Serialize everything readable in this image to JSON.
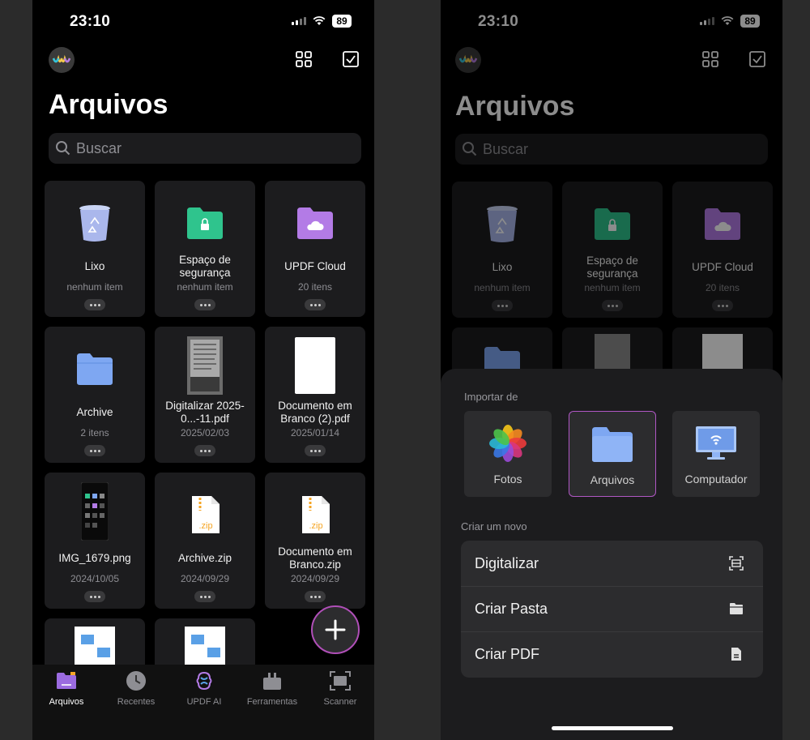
{
  "status": {
    "time": "23:10",
    "battery": "89"
  },
  "title": "Arquivos",
  "search": {
    "placeholder": "Buscar"
  },
  "grid": [
    {
      "name": "Lixo",
      "meta": "nenhum item",
      "icon": "trash-icon"
    },
    {
      "name": "Espaço de segurança",
      "meta": "nenhum item",
      "icon": "secure-folder-icon"
    },
    {
      "name": "UPDF Cloud",
      "meta": "20 itens",
      "icon": "cloud-folder-icon"
    },
    {
      "name": "Archive",
      "meta": "2 itens",
      "icon": "folder-icon"
    },
    {
      "name": "Digitalizar 2025-0...-11.pdf",
      "meta": "2025/02/03",
      "icon": "scan-thumbnail"
    },
    {
      "name": "Documento em Branco (2).pdf",
      "meta": "2025/01/14",
      "icon": "blank-doc-thumbnail"
    },
    {
      "name": "IMG_1679.png",
      "meta": "2024/10/05",
      "icon": "phone-screenshot-thumbnail"
    },
    {
      "name": "Archive.zip",
      "meta": "2024/09/29",
      "icon": "zip-icon"
    },
    {
      "name": "Documento em Branco.zip",
      "meta": "2024/09/29",
      "icon": "zip-icon"
    }
  ],
  "zip_label": ".zip",
  "tabs": [
    {
      "label": "Arquivos",
      "icon": "folder-tab-icon",
      "active": true
    },
    {
      "label": "Recentes",
      "icon": "clock-icon",
      "active": false
    },
    {
      "label": "UPDF AI",
      "icon": "ai-icon",
      "active": false
    },
    {
      "label": "Ferramentas",
      "icon": "toolbox-icon",
      "active": false
    },
    {
      "label": "Scanner",
      "icon": "scanner-icon",
      "active": false
    }
  ],
  "sheet": {
    "import_heading": "Importar de",
    "import_options": [
      {
        "label": "Fotos",
        "icon": "photos-icon"
      },
      {
        "label": "Arquivos",
        "icon": "files-folder-icon",
        "selected": true
      },
      {
        "label": "Computador",
        "icon": "computer-wifi-icon"
      }
    ],
    "create_heading": "Criar um novo",
    "create_options": [
      {
        "label": "Digitalizar",
        "icon": "scan-icon"
      },
      {
        "label": "Criar Pasta",
        "icon": "new-folder-icon"
      },
      {
        "label": "Criar PDF",
        "icon": "new-pdf-icon"
      }
    ]
  },
  "colors": {
    "accent": "#b04fb8",
    "secure_folder": "#2fc48d",
    "cloud_folder": "#b37be6",
    "folder": "#7ea7f2",
    "zip": "#f5a524"
  }
}
